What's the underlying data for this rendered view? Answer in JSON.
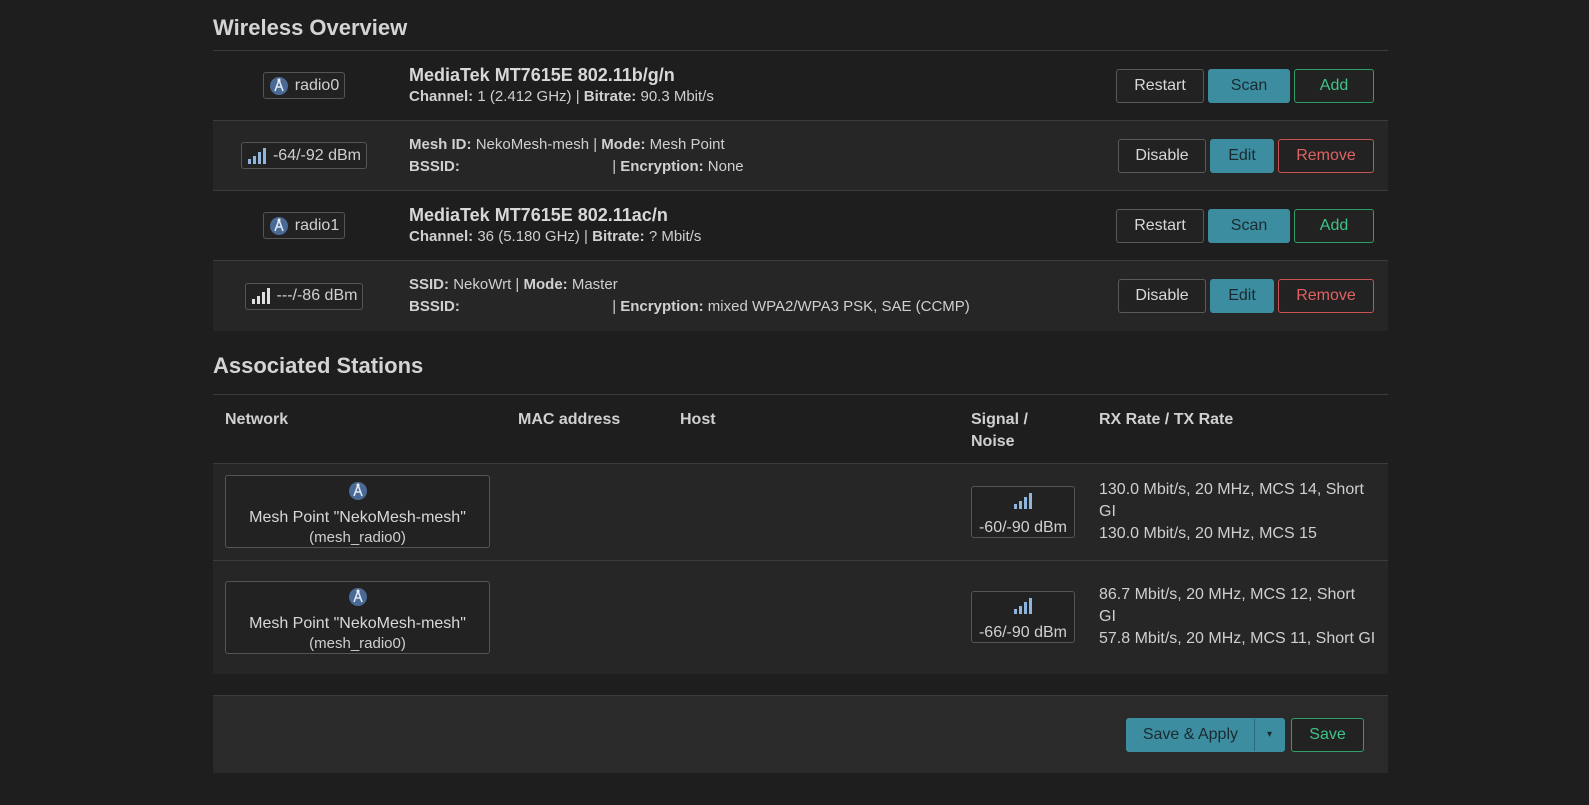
{
  "wireless_overview": {
    "title": "Wireless Overview",
    "rows": [
      {
        "kind": "radio",
        "badge": "radio0",
        "title": "MediaTek MT7615E 802.11b/g/n",
        "l2_k1": "Channel:",
        "l2_v1": "1 (2.412 GHz) |",
        "l2_k2": "Bitrate:",
        "l2_v2": "90.3 Mbit/s",
        "buttons": [
          "Restart",
          "Scan",
          "Add"
        ]
      },
      {
        "kind": "net",
        "badge": "-64/-92 dBm",
        "l1_k1": "Mesh ID:",
        "l1_v1": "NekoMesh-mesh |",
        "l1_k2": "Mode:",
        "l1_v2": "Mesh Point",
        "l2_k1": "BSSID:",
        "l2_v1": "|",
        "l2_k2": "Encryption:",
        "l2_v2": "None",
        "buttons": [
          "Disable",
          "Edit",
          "Remove"
        ]
      },
      {
        "kind": "radio",
        "badge": "radio1",
        "title": "MediaTek MT7615E 802.11ac/n",
        "l2_k1": "Channel:",
        "l2_v1": "36 (5.180 GHz) |",
        "l2_k2": "Bitrate:",
        "l2_v2": "? Mbit/s",
        "buttons": [
          "Restart",
          "Scan",
          "Add"
        ]
      },
      {
        "kind": "net",
        "badge": "---/-86 dBm",
        "l1_k1": "SSID:",
        "l1_v1": "NekoWrt |",
        "l1_k2": "Mode:",
        "l1_v2": "Master",
        "l2_k1": "BSSID:",
        "l2_v1": "|",
        "l2_k2": "Encryption:",
        "l2_v2": "mixed WPA2/WPA3 PSK, SAE (CCMP)",
        "buttons": [
          "Disable",
          "Edit",
          "Remove"
        ]
      }
    ]
  },
  "associated_stations": {
    "title": "Associated Stations",
    "columns": [
      "Network",
      "MAC address",
      "Host",
      "Signal / Noise",
      "RX Rate / TX Rate"
    ],
    "rows": [
      {
        "network_title": "Mesh Point \"NekoMesh-mesh\"",
        "network_sub": "(mesh_radio0)",
        "mac": "",
        "host": "",
        "signal": "-60/-90 dBm",
        "rx": "130.0 Mbit/s, 20 MHz, MCS 14, Short GI",
        "tx": "130.0 Mbit/s, 20 MHz, MCS 15"
      },
      {
        "network_title": "Mesh Point \"NekoMesh-mesh\"",
        "network_sub": "(mesh_radio0)",
        "mac": "",
        "host": "",
        "signal": "-66/-90 dBm",
        "rx": "86.7 Mbit/s, 20 MHz, MCS 12, Short GI",
        "tx": "57.8 Mbit/s, 20 MHz, MCS 11, Short GI"
      }
    ]
  },
  "footer": {
    "save_apply": "Save & Apply",
    "caret": "▾",
    "save": "Save"
  },
  "icons": {
    "radio": "wifi-radio-icon",
    "signal": "signal-strength-icon"
  },
  "colors": {
    "background": "#1e1e1e",
    "action": "#3d8da0",
    "positive": "#3fc38a",
    "negative": "#e06262"
  }
}
